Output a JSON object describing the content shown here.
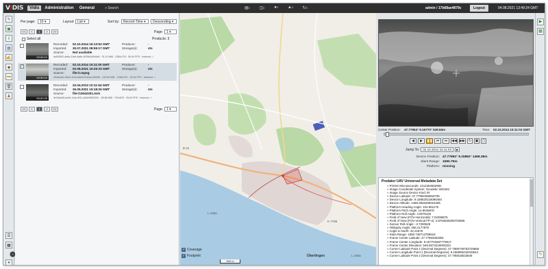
{
  "topbar": {
    "logo": [
      "V",
      "I",
      "DIS"
    ],
    "nav": [
      "Vidis",
      "Administration",
      "General"
    ],
    "search": "» Search",
    "counters": [
      "0",
      "0",
      "0",
      "0",
      "0"
    ],
    "user": "admin / 17b68ae4879c",
    "logout": "Logout",
    "datetime": "04.08.2021 13:49:24 GMT"
  },
  "list": {
    "per_page_label": "Per page:",
    "per_page_value": "10",
    "layout_label": "Layout:",
    "layout_value": "List",
    "sort_label": "Sort by:",
    "sort_value": "Record-Time",
    "order_value": "Descending",
    "page_label": "Page:",
    "page_value": "1",
    "products": "Products: 3",
    "select_all": "Select all",
    "pager": [
      "<<",
      "<",
      "1",
      ">",
      ">>"
    ],
    "rows": [
      {
        "duration": "00:00:10",
        "recorded_label": "Recorded:",
        "recorded": "02.10.2014 16:13:52 GMT",
        "imported_label": "Imported:",
        "imported": "30.07.2021 08:59:17 GMT",
        "source_label": "Source:",
        "source": "Not available",
        "details": "de0f2802-4e6a-11eb-9a8e-9026b3d2e5a9 · 31.10 MiB · 1280x720 · 59.94 FPS · Indexed: ✓",
        "producer_label": "Producer:",
        "producer": "-",
        "storage_label": "Storage(s):",
        "storage": "sts",
        "checked": false
      },
      {
        "duration": "00:00:10",
        "recorded_label": "Recorded:",
        "recorded": "02.10.2014 15:11:00 GMT",
        "imported_label": "Imported:",
        "imported": "02.08.2021 15:25:33 GMT",
        "source_label": "Source:",
        "source": "file:/r.mpeg",
        "details": "e63aea0c-f3a1f-11eb-b6e5-0242ac130006 · 415.62 MiB · 1280x720 · 59.94 FPS · Indexed: ✓",
        "producer_label": "Producer:",
        "producer": "-",
        "storage_label": "Storage(s):",
        "storage": "sts",
        "checked": true
      },
      {
        "duration": "00:02:25",
        "recorded_label": "Recorded:",
        "recorded": "22.04.2013 10:11:54 GMT",
        "imported_label": "Imported:",
        "imported": "26.05.2021 15:18:26 GMT",
        "source_label": "Source:",
        "source": "file:/13042201.m2v",
        "details": "9e34de06-be3b-11eb-9f41-6d2e99f02001 · 85.86 MiB · 720x576 · 25.00 FPS · Indexed: ✓",
        "producer_label": "Producer:",
        "producer": "-",
        "storage_label": "Storage(s):",
        "storage": "sts",
        "checked": false
      }
    ]
  },
  "map": {
    "coverage_label": "Coverage",
    "footprint_label": "Footprint",
    "scale_label": "500 m",
    "town_label": "Überlingen",
    "road_labels": [
      "L 195a",
      "K 7786",
      "B 31",
      "L 195a"
    ]
  },
  "player": {
    "center_position_label": "Center Position:",
    "center_position": "47.77964° 9.16770° 549.56m",
    "time_label": "Time:",
    "time": "02.10.2014 15:11:03 GMT",
    "jump_label": "Jump To:",
    "jump_value": "02.10.2014 15:11:03",
    "device_position_label": "Device Position:",
    "device_position": "47.77992° 9.15862° 1498.38m",
    "slant_range_label": "Slant Range:",
    "slant_range": "1590.75m",
    "platform_label": "Platform:",
    "platform": "missing"
  },
  "metadata": {
    "title": "Predator UAV Universal Metadata Set",
    "items": [
      "» POSIX Microseconds: 1412262662981",
      "» Image Coordinate System: Geodetic WGS84",
      "» Image Source Device Kind: IR",
      "» Device Latitude: 47.77992466553735",
      "» Device Longitude: 9.158620119096484",
      "» Device Altitude: 1498.3846299316406",
      "» Platform Heading Angle: 104.861175",
      "» Platform Pitch Angle: 14.9046875",
      "» Platform Roll Angle: 4.0078125",
      "» Field of View (FOV-Horizontal): 7.04296875",
      "» Field of View (FOV-Vertical FP-4): 3.8753535305703696",
      "» Sensor Roll Angle: -3.7200625",
      "» Obliquity Angle: 256.4177875",
      "» Angle to North: 32.21875",
      "» Slant Range: 1590.748713759518",
      "» Frame Center Latitude: 47.77964063381",
      "» Frame Center Longitude: 9.167703487779617",
      "» Frame Center Elevation: 549.5574219000323",
      "» Corner Latitude Point 1 (Decimal Degrees): 47.7908749753725865",
      "» Corner Longitude Point 1 (Decimal Degrees): 9.166995442915544",
      "» Corner Latitude Point 2 (Decimal Degrees): 47.790818533845"
    ]
  }
}
